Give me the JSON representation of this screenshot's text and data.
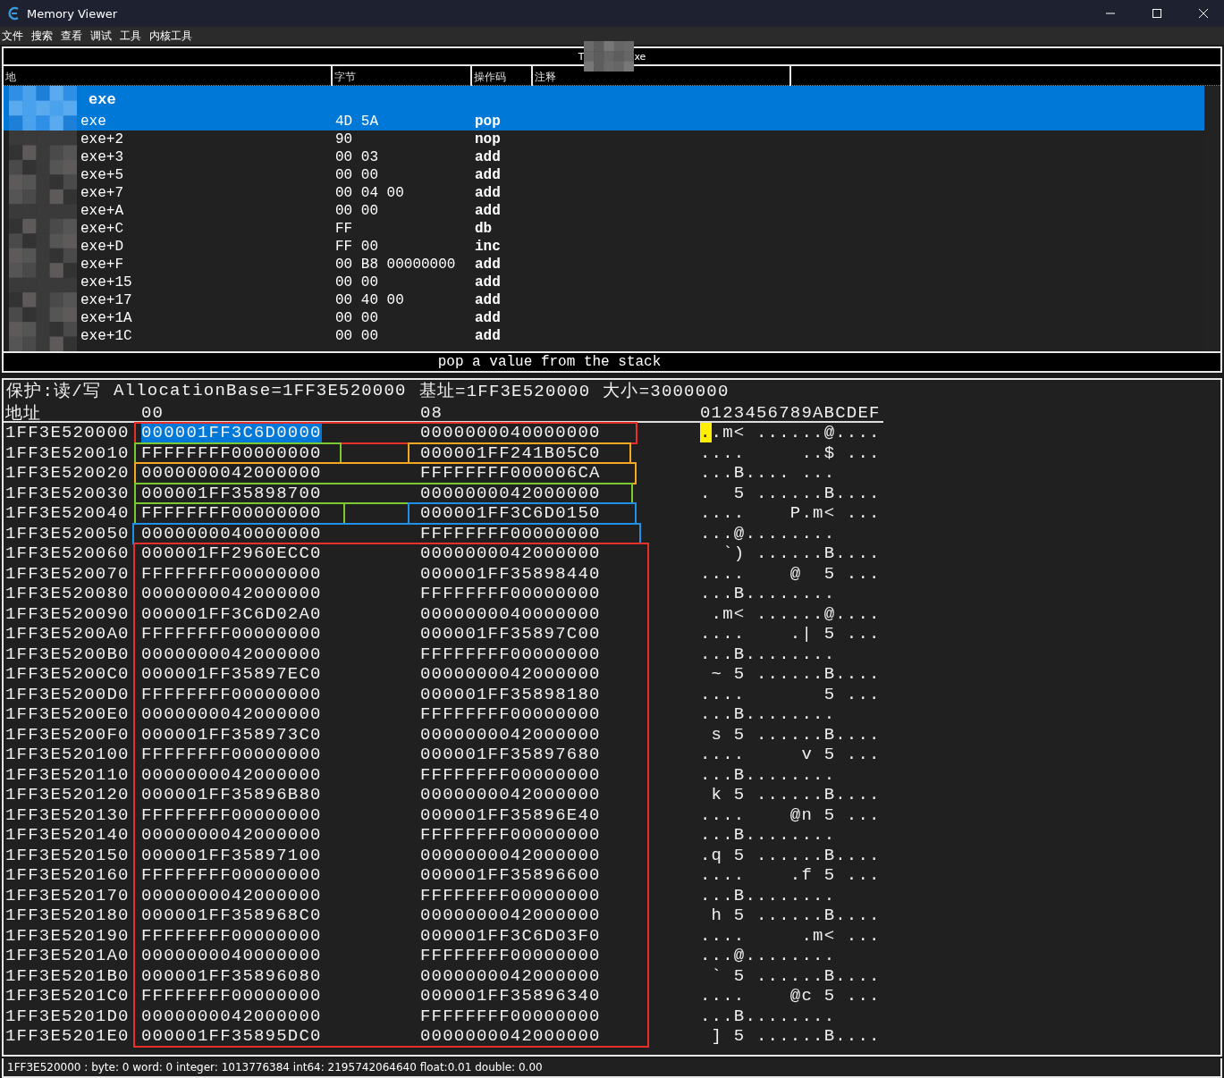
{
  "window": {
    "title": "Memory Viewer"
  },
  "menu": [
    "文件",
    "搜索",
    "查看",
    "调试",
    "工具",
    "内核工具"
  ],
  "process_bar": {
    "before": "T",
    "after": "xe"
  },
  "disassembly": {
    "columns": [
      "地",
      "字节",
      "操作码",
      "注释"
    ],
    "rows": [
      {
        "kind": "module",
        "address": "exe",
        "selected": true
      },
      {
        "kind": "instruction",
        "address": "exe",
        "bytes": "4D 5A",
        "opcode": "pop",
        "selected": true
      },
      {
        "kind": "instruction",
        "address": "exe+2",
        "bytes": "90",
        "opcode": "nop",
        "selected": false
      },
      {
        "kind": "instruction",
        "address": "exe+3",
        "bytes": "00 03",
        "opcode": "add",
        "selected": false
      },
      {
        "kind": "instruction",
        "address": "exe+5",
        "bytes": "00 00",
        "opcode": "add",
        "selected": false
      },
      {
        "kind": "instruction",
        "address": "exe+7",
        "bytes": "00 04 00",
        "opcode": "add",
        "selected": false
      },
      {
        "kind": "instruction",
        "address": "exe+A",
        "bytes": "00 00",
        "opcode": "add",
        "selected": false
      },
      {
        "kind": "instruction",
        "address": "exe+C",
        "bytes": "FF",
        "opcode": "db",
        "selected": false
      },
      {
        "kind": "instruction",
        "address": "exe+D",
        "bytes": "FF 00",
        "opcode": "inc",
        "selected": false
      },
      {
        "kind": "instruction",
        "address": "exe+F",
        "bytes": "00 B8 00000000",
        "opcode": "add",
        "selected": false
      },
      {
        "kind": "instruction",
        "address": "exe+15",
        "bytes": "00 00",
        "opcode": "add",
        "selected": false
      },
      {
        "kind": "instruction",
        "address": "exe+17",
        "bytes": "00 40 00",
        "opcode": "add",
        "selected": false
      },
      {
        "kind": "instruction",
        "address": "exe+1A",
        "bytes": "00 00",
        "opcode": "add",
        "selected": false
      },
      {
        "kind": "instruction",
        "address": "exe+1C",
        "bytes": "00 00",
        "opcode": "add",
        "selected": false
      }
    ],
    "description": "pop a value from the stack"
  },
  "hex_view": {
    "protection": "保护:读/写",
    "allocation_base": "AllocationBase=1FF3E520000",
    "base": "基址=1FF3E520000",
    "size": "大小=3000000",
    "columns": [
      "地址",
      "00",
      "08",
      "0123456789ABCDEF"
    ],
    "rows": [
      {
        "address": "1FF3E520000",
        "col_00": "000001FF3C6D0000",
        "col_08": "0000000040000000",
        "ascii": "..m< ......@....",
        "selected": true
      },
      {
        "address": "1FF3E520010",
        "col_00": "FFFFFFFF00000000",
        "col_08": "000001FF241B05C0",
        "ascii": "....     ..$ ...",
        "selected": false
      },
      {
        "address": "1FF3E520020",
        "col_00": "0000000042000000",
        "col_08": "FFFFFFFF000006CA",
        "ascii": "...B.... ...    ",
        "selected": false
      },
      {
        "address": "1FF3E520030",
        "col_00": "000001FF35898700",
        "col_08": "0000000042000000",
        "ascii": ".  5 ......B....",
        "selected": false
      },
      {
        "address": "1FF3E520040",
        "col_00": "FFFFFFFF00000000",
        "col_08": "000001FF3C6D0150",
        "ascii": "....    P.m< ...",
        "selected": false
      },
      {
        "address": "1FF3E520050",
        "col_00": "0000000040000000",
        "col_08": "FFFFFFFF00000000",
        "ascii": "...@........    ",
        "selected": false
      },
      {
        "address": "1FF3E520060",
        "col_00": "000001FF2960ECC0",
        "col_08": "0000000042000000",
        "ascii": "  `) ......B....",
        "selected": false
      },
      {
        "address": "1FF3E520070",
        "col_00": "FFFFFFFF00000000",
        "col_08": "000001FF35898440",
        "ascii": "....    @  5 ...",
        "selected": false
      },
      {
        "address": "1FF3E520080",
        "col_00": "0000000042000000",
        "col_08": "FFFFFFFF00000000",
        "ascii": "...B........    ",
        "selected": false
      },
      {
        "address": "1FF3E520090",
        "col_00": "000001FF3C6D02A0",
        "col_08": "0000000040000000",
        "ascii": " .m< ......@....",
        "selected": false
      },
      {
        "address": "1FF3E5200A0",
        "col_00": "FFFFFFFF00000000",
        "col_08": "000001FF35897C00",
        "ascii": "....    .| 5 ...",
        "selected": false
      },
      {
        "address": "1FF3E5200B0",
        "col_00": "0000000042000000",
        "col_08": "FFFFFFFF00000000",
        "ascii": "...B........    ",
        "selected": false
      },
      {
        "address": "1FF3E5200C0",
        "col_00": "000001FF35897EC0",
        "col_08": "0000000042000000",
        "ascii": " ~ 5 ......B....",
        "selected": false
      },
      {
        "address": "1FF3E5200D0",
        "col_00": "FFFFFFFF00000000",
        "col_08": "000001FF35898180",
        "ascii": "....       5 ...",
        "selected": false
      },
      {
        "address": "1FF3E5200E0",
        "col_00": "0000000042000000",
        "col_08": "FFFFFFFF00000000",
        "ascii": "...B........    ",
        "selected": false
      },
      {
        "address": "1FF3E5200F0",
        "col_00": "000001FF358973C0",
        "col_08": "0000000042000000",
        "ascii": " s 5 ......B....",
        "selected": false
      },
      {
        "address": "1FF3E520100",
        "col_00": "FFFFFFFF00000000",
        "col_08": "000001FF35897680",
        "ascii": "....     v 5 ...",
        "selected": false
      },
      {
        "address": "1FF3E520110",
        "col_00": "0000000042000000",
        "col_08": "FFFFFFFF00000000",
        "ascii": "...B........    ",
        "selected": false
      },
      {
        "address": "1FF3E520120",
        "col_00": "000001FF35896B80",
        "col_08": "0000000042000000",
        "ascii": " k 5 ......B....",
        "selected": false
      },
      {
        "address": "1FF3E520130",
        "col_00": "FFFFFFFF00000000",
        "col_08": "000001FF35896E40",
        "ascii": "....    @n 5 ...",
        "selected": false
      },
      {
        "address": "1FF3E520140",
        "col_00": "0000000042000000",
        "col_08": "FFFFFFFF00000000",
        "ascii": "...B........    ",
        "selected": false
      },
      {
        "address": "1FF3E520150",
        "col_00": "000001FF35897100",
        "col_08": "0000000042000000",
        "ascii": ".q 5 ......B....",
        "selected": false
      },
      {
        "address": "1FF3E520160",
        "col_00": "FFFFFFFF00000000",
        "col_08": "000001FF35896600",
        "ascii": "....    .f 5 ...",
        "selected": false
      },
      {
        "address": "1FF3E520170",
        "col_00": "0000000042000000",
        "col_08": "FFFFFFFF00000000",
        "ascii": "...B........    ",
        "selected": false
      },
      {
        "address": "1FF3E520180",
        "col_00": "000001FF358968C0",
        "col_08": "0000000042000000",
        "ascii": " h 5 ......B....",
        "selected": false
      },
      {
        "address": "1FF3E520190",
        "col_00": "FFFFFFFF00000000",
        "col_08": "000001FF3C6D03F0",
        "ascii": "....     .m< ...",
        "selected": false
      },
      {
        "address": "1FF3E5201A0",
        "col_00": "0000000040000000",
        "col_08": "FFFFFFFF00000000",
        "ascii": "...@........    ",
        "selected": false
      },
      {
        "address": "1FF3E5201B0",
        "col_00": "000001FF35896080",
        "col_08": "0000000042000000",
        "ascii": " ` 5 ......B....",
        "selected": false
      },
      {
        "address": "1FF3E5201C0",
        "col_00": "FFFFFFFF00000000",
        "col_08": "000001FF35896340",
        "ascii": "....    @c 5 ...",
        "selected": false
      },
      {
        "address": "1FF3E5201D0",
        "col_00": "0000000042000000",
        "col_08": "FFFFFFFF00000000",
        "ascii": "...B........    ",
        "selected": false
      },
      {
        "address": "1FF3E5201E0",
        "col_00": "000001FF35895DC0",
        "col_08": "0000000042000000",
        "ascii": " ] 5 ......B....",
        "selected": false
      }
    ],
    "annotations": [
      {
        "color": "#e8302a"
      },
      {
        "color": "#7cc832"
      },
      {
        "color": "#f5a623"
      },
      {
        "color": "#f5a623"
      },
      {
        "color": "#7cc832"
      },
      {
        "color": "#7cc832"
      },
      {
        "color": "#1e90e6"
      },
      {
        "color": "#1e90e6"
      },
      {
        "color": "#e8302a"
      }
    ]
  },
  "status_bar": "1FF3E520000 : byte: 0 word: 0 integer: 1013776384 int64: 2195742064640 float:0.01 double: 0.00"
}
